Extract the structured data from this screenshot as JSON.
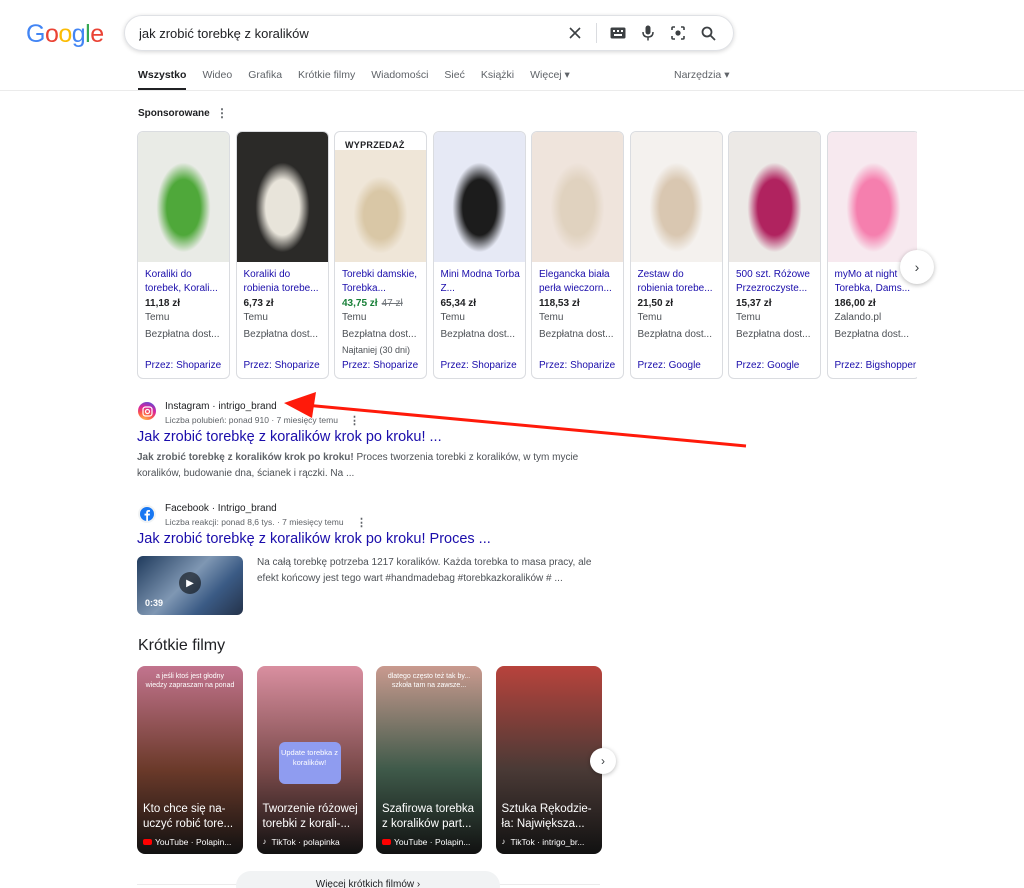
{
  "search": {
    "query": "jak zrobić torebkę z koralików",
    "clear_icon": "close-icon",
    "keyboard_icon": "keyboard-icon",
    "mic_icon": "mic-icon",
    "lens_icon": "camera-lens-icon",
    "search_icon": "search-icon"
  },
  "logo": {
    "letters": [
      "G",
      "o",
      "o",
      "g",
      "l",
      "e"
    ],
    "colors": [
      "#4285f4",
      "#ea4335",
      "#fbbc05",
      "#4285f4",
      "#34a853",
      "#ea4335"
    ]
  },
  "tabs": [
    {
      "label": "Wszystko",
      "active": true
    },
    {
      "label": "Wideo"
    },
    {
      "label": "Grafika"
    },
    {
      "label": "Krótkie filmy"
    },
    {
      "label": "Wiadomości"
    },
    {
      "label": "Sieć"
    },
    {
      "label": "Książki"
    },
    {
      "label": "Więcej ▾"
    }
  ],
  "tools_label": "Narzędzia ▾",
  "sponsored": {
    "label": "Sponsorowane",
    "menu_glyph": "⋮",
    "products": [
      {
        "title": "Koraliki do torebek, Korali...",
        "price": "11,18 zł",
        "store": "Temu",
        "shipping": "Bezpłatna dost...",
        "via": "Przez: Shoparize",
        "img": [
          "#e9ebe6",
          "#4fa83a"
        ]
      },
      {
        "title": "Koraliki do robienia torebe...",
        "price": "6,73 zł",
        "store": "Temu",
        "shipping": "Bezpłatna dost...",
        "via": "Przez: Shoparize",
        "img": [
          "#2b2a28",
          "#e8e4da"
        ]
      },
      {
        "title": "Torebki damskie, Torebka...",
        "price": "43,75 zł",
        "old_price": "47 zł",
        "sale": true,
        "badge": "WYPRZEDAŻ",
        "store": "Temu",
        "shipping": "Bezpłatna dost...",
        "note": "Najtaniej (30 dni)",
        "via": "Przez: Shoparize",
        "img": [
          "#efe6d8",
          "#d9c7a6"
        ]
      },
      {
        "title": "Mini Modna Torba Z...",
        "price": "65,34 zł",
        "store": "Temu",
        "shipping": "Bezpłatna dost...",
        "via": "Przez: Shoparize",
        "img": [
          "#e6e9f5",
          "#1c1c1c"
        ]
      },
      {
        "title": "Elegancka biała perła wieczorn...",
        "price": "118,53 zł",
        "store": "Temu",
        "shipping": "Bezpłatna dost...",
        "via": "Przez: Shoparize",
        "img": [
          "#efe4dc",
          "#e0d2bf"
        ]
      },
      {
        "title": "Zestaw do robienia torebe...",
        "price": "21,50 zł",
        "store": "Temu",
        "shipping": "Bezpłatna dost...",
        "via": "Przez: Google",
        "img": [
          "#f4f1ee",
          "#d9c7b1"
        ]
      },
      {
        "title": "500 szt. Różowe Przezroczyste...",
        "price": "15,37 zł",
        "store": "Temu",
        "shipping": "Bezpłatna dost...",
        "via": "Przez: Google",
        "img": [
          "#ece9e6",
          "#b0235f"
        ]
      },
      {
        "title": "myMo at night Torebka, Dams...",
        "price": "186,00 zł",
        "store": "Zalando.pl",
        "shipping": "Bezpłatna dost...",
        "via": "Przez: Bigshopper",
        "img": [
          "#f7e9ef",
          "#f57fae"
        ]
      }
    ]
  },
  "results": [
    {
      "source": "Instagram · intrigo_brand",
      "meta": "Liczba polubień: ponad 910 · 7 miesięcy temu",
      "title": "Jak zrobić torebkę z koralików krok po kroku! ...",
      "snippet_bold": "Jak zrobić torebkę z koralików krok po kroku!",
      "snippet_rest": " Proces tworzenia torebki z koralików, w tym mycie koralików, budowanie dna, ścianek i rączki. Na ...",
      "icon": "instagram-icon"
    },
    {
      "source": "Facebook · Intrigo_brand",
      "meta": "Liczba reakcji: ponad 8,6 tys. · 7 miesięcy temu",
      "title": "Jak zrobić torebkę z koralików krok po kroku! Proces ...",
      "snippet": "Na całą torebkę potrzeba 1217 koralików. Każda torebka to masa pracy, ale efekt końcowy jest tego wart #handmadebag #torebkazkoralików # ...",
      "duration": "0:39",
      "icon": "facebook-icon"
    }
  ],
  "short_videos": {
    "heading": "Krótkie filmy",
    "items": [
      {
        "caption": "Kto chce się na-uczyć robić tore...",
        "source": "YouTube · Polapin...",
        "top": "a jeśli ktoś jest głodny wiedzy zapraszam na ponad",
        "platform": "youtube",
        "colors": [
          "#6b3a2a",
          "#c2748e"
        ]
      },
      {
        "caption": "Tworzenie różowej torebki z korali-...",
        "source": "TikTok · polapinka",
        "platform": "tiktok",
        "sticker": "Update torebka z koralików!",
        "colors": [
          "#7a4a4a",
          "#d98fa0"
        ]
      },
      {
        "caption": "Szafirowa torebka z koralików part...",
        "source": "YouTube · Polapin...",
        "top": "dlatego często też tak by... szkoła tam na zawsze...",
        "platform": "youtube",
        "colors": [
          "#3f5a4a",
          "#c99a8f"
        ]
      },
      {
        "caption": "Sztuka Rękodzie-ła: Największa...",
        "source": "TikTok · intrigo_br...",
        "platform": "tiktok",
        "colors": [
          "#4a3a36",
          "#b8433c"
        ]
      }
    ]
  },
  "more_videos_label": "Więcej krótkich filmów  ›",
  "next_glyph": "›",
  "accent": {
    "link": "#1a0dab",
    "arrow": "#ff1a0a"
  }
}
